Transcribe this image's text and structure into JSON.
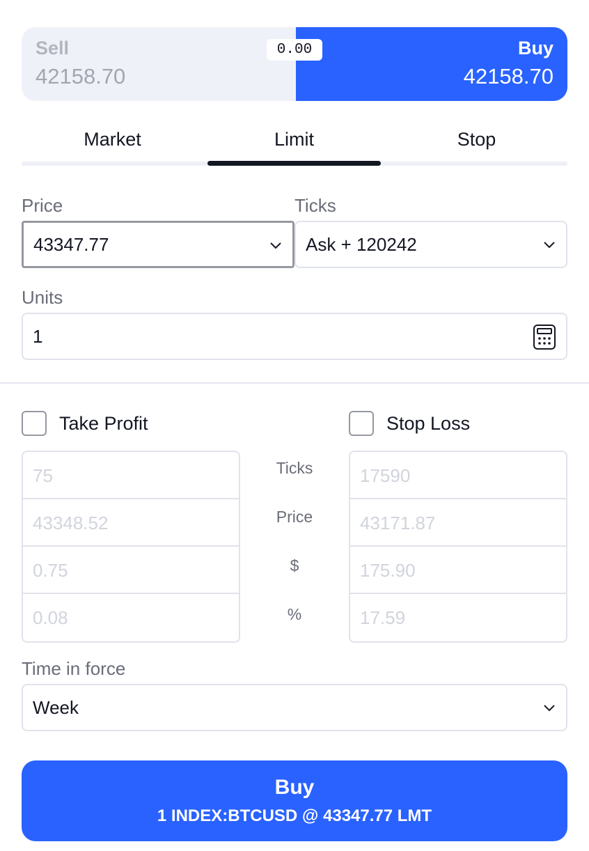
{
  "header": {
    "sell_label": "Sell",
    "sell_price": "42158.70",
    "buy_label": "Buy",
    "buy_price": "42158.70",
    "spread": "0.00"
  },
  "tabs": [
    {
      "label": "Market"
    },
    {
      "label": "Limit",
      "active": true
    },
    {
      "label": "Stop"
    }
  ],
  "price": {
    "label": "Price",
    "value": "43347.77"
  },
  "ticks": {
    "label": "Ticks",
    "value": "Ask + 120242"
  },
  "units": {
    "label": "Units",
    "value": "1"
  },
  "take_profit": {
    "label": "Take Profit",
    "checked": false,
    "ticks": "75",
    "price": "43348.52",
    "usd": "0.75",
    "percent": "0.08"
  },
  "stop_loss": {
    "label": "Stop Loss",
    "checked": false,
    "ticks": "17590",
    "price": "43171.87",
    "usd": "175.90",
    "percent": "17.59"
  },
  "row_labels": {
    "ticks": "Ticks",
    "price": "Price",
    "usd": "$",
    "percent": "%"
  },
  "time_in_force": {
    "label": "Time in force",
    "value": "Week"
  },
  "submit": {
    "title": "Buy",
    "subtitle": "1 INDEX:BTCUSD @ 43347.77 LMT"
  },
  "colors": {
    "buy": "#2962ff",
    "sell_bg": "#eef1f8"
  },
  "icons": {
    "dropdown": "chevron-down-icon",
    "calculator": "calculator-icon"
  }
}
